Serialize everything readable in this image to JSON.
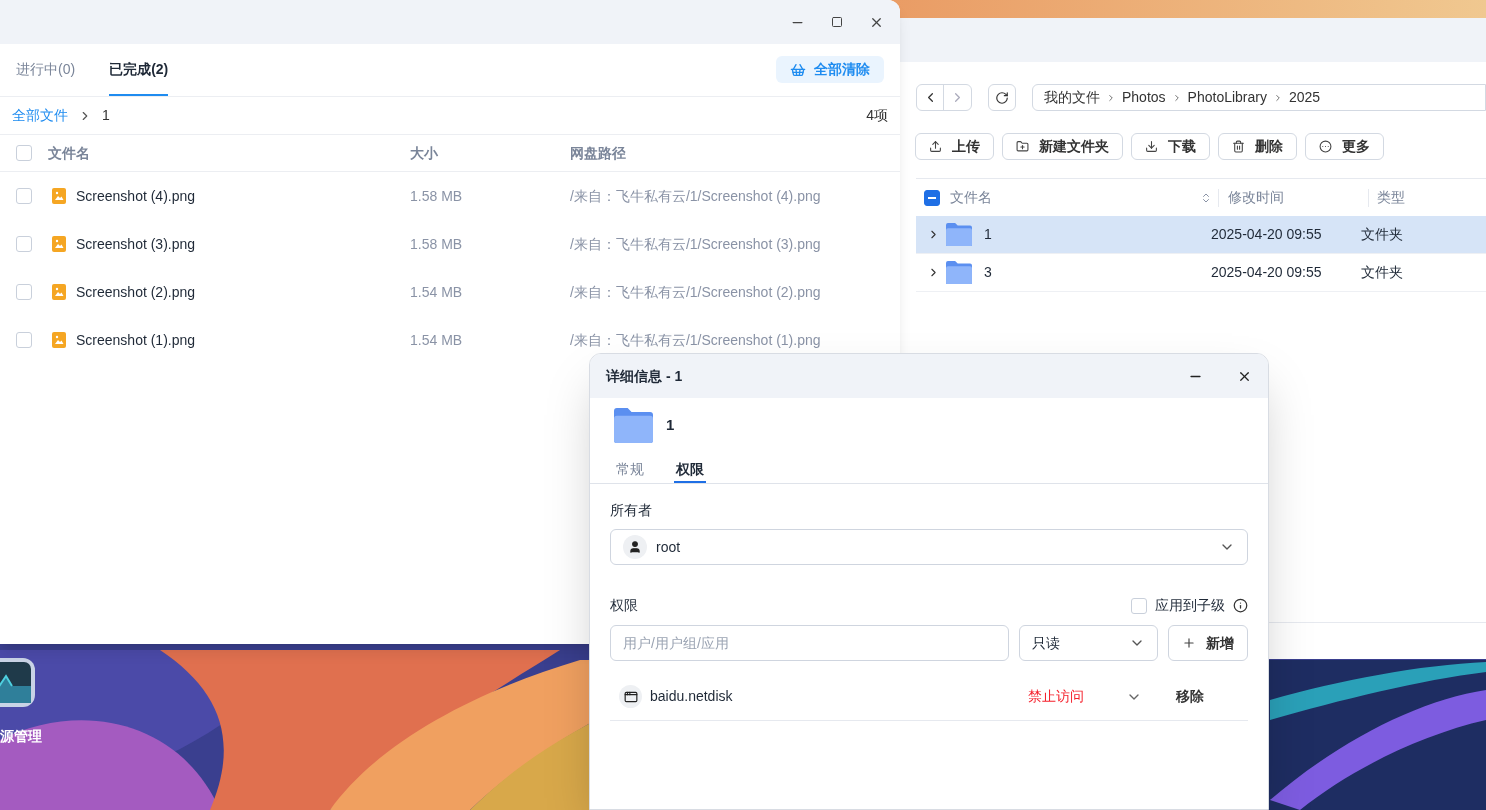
{
  "desktop": {
    "icons": [
      {
        "label": "源管理"
      }
    ]
  },
  "transfer_window": {
    "tabs": [
      {
        "label": "进行中(0)",
        "selected": false
      },
      {
        "label": "已完成(2)",
        "selected": true
      }
    ],
    "clear_button": "全部清除",
    "breadcrumb": [
      "全部文件",
      "1"
    ],
    "count": "4项",
    "select_all": {
      "checked": false
    },
    "columns": [
      "文件名",
      "大小",
      "网盘路径"
    ],
    "rows": [
      {
        "name": "Screenshot (4).png",
        "size": "1.58 MB",
        "path": "/来自：飞牛私有云/1/Screenshot (4).png",
        "checked": false
      },
      {
        "name": "Screenshot (3).png",
        "size": "1.58 MB",
        "path": "/来自：飞牛私有云/1/Screenshot (3).png",
        "checked": false
      },
      {
        "name": "Screenshot (2).png",
        "size": "1.54 MB",
        "path": "/来自：飞牛私有云/1/Screenshot (2).png",
        "checked": false
      },
      {
        "name": "Screenshot (1).png",
        "size": "1.54 MB",
        "path": "/来自：飞牛私有云/1/Screenshot (1).png",
        "checked": false
      }
    ]
  },
  "file_window": {
    "breadcrumb": [
      "我的文件",
      "Photos",
      "PhotoLibrary",
      "2025"
    ],
    "toolbar": [
      {
        "label": "上传",
        "kind": "upload"
      },
      {
        "label": "新建文件夹",
        "kind": "new-folder"
      },
      {
        "label": "下载",
        "kind": "download"
      },
      {
        "label": "删除",
        "kind": "delete"
      },
      {
        "label": "更多",
        "kind": "more"
      }
    ],
    "select_all": {
      "indeterminate": true
    },
    "columns": [
      "文件名",
      "修改时间",
      "类型"
    ],
    "rows": [
      {
        "name": "1",
        "modified": "2025-04-20 09:55",
        "type": "文件夹",
        "selected": true
      },
      {
        "name": "3",
        "modified": "2025-04-20 09:55",
        "type": "文件夹",
        "selected": false
      }
    ]
  },
  "details_dialog": {
    "title": "详细信息 - 1",
    "name": "1",
    "tabs": [
      {
        "label": "常规",
        "selected": false
      },
      {
        "label": "权限",
        "selected": true
      }
    ],
    "owner_label": "所有者",
    "owner": "root",
    "permission_label": "权限",
    "apply_to_children": {
      "label": "应用到子级",
      "checked": false
    },
    "user_placeholder": "用户/用户组/应用",
    "access_select": "只读",
    "add_button": "新增",
    "entries": [
      {
        "name": "baidu.netdisk",
        "access": "禁止访问",
        "color": "#f5222d",
        "remove": "移除"
      }
    ]
  }
}
